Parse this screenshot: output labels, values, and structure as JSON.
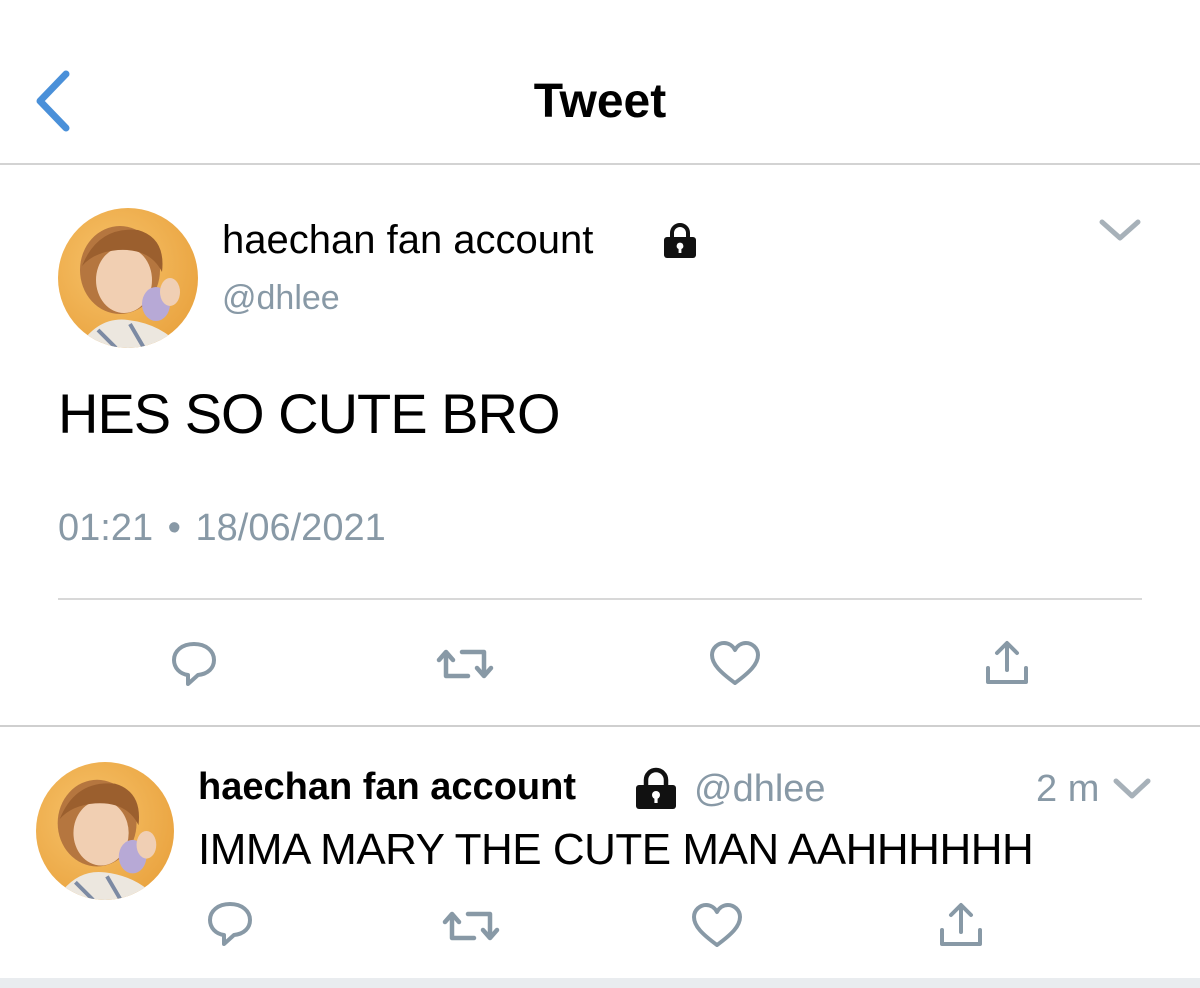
{
  "colors": {
    "accent": "#4a90d9",
    "icon_gray": "#8899a6",
    "text": "#000000",
    "divider": "#d3d3d3"
  },
  "header": {
    "title": "Tweet",
    "back_icon": "chevron-left-icon"
  },
  "main_tweet": {
    "display_name": "haechan fan account",
    "handle": "@dhlee",
    "protected_icon": "lock-icon",
    "text": "HES SO CUTE BRO",
    "time": "01:21",
    "separator": "•",
    "date": "18/06/2021",
    "actions": [
      "reply-icon",
      "retweet-icon",
      "like-icon",
      "share-icon"
    ]
  },
  "reply_tweet": {
    "display_name": "haechan fan account",
    "handle": "@dhlee",
    "protected_icon": "lock-icon",
    "relative_time": "2 m",
    "text": "IMMA MARY THE CUTE MAN AAHHHHHH",
    "actions": [
      "reply-icon",
      "retweet-icon",
      "like-icon",
      "share-icon"
    ]
  }
}
